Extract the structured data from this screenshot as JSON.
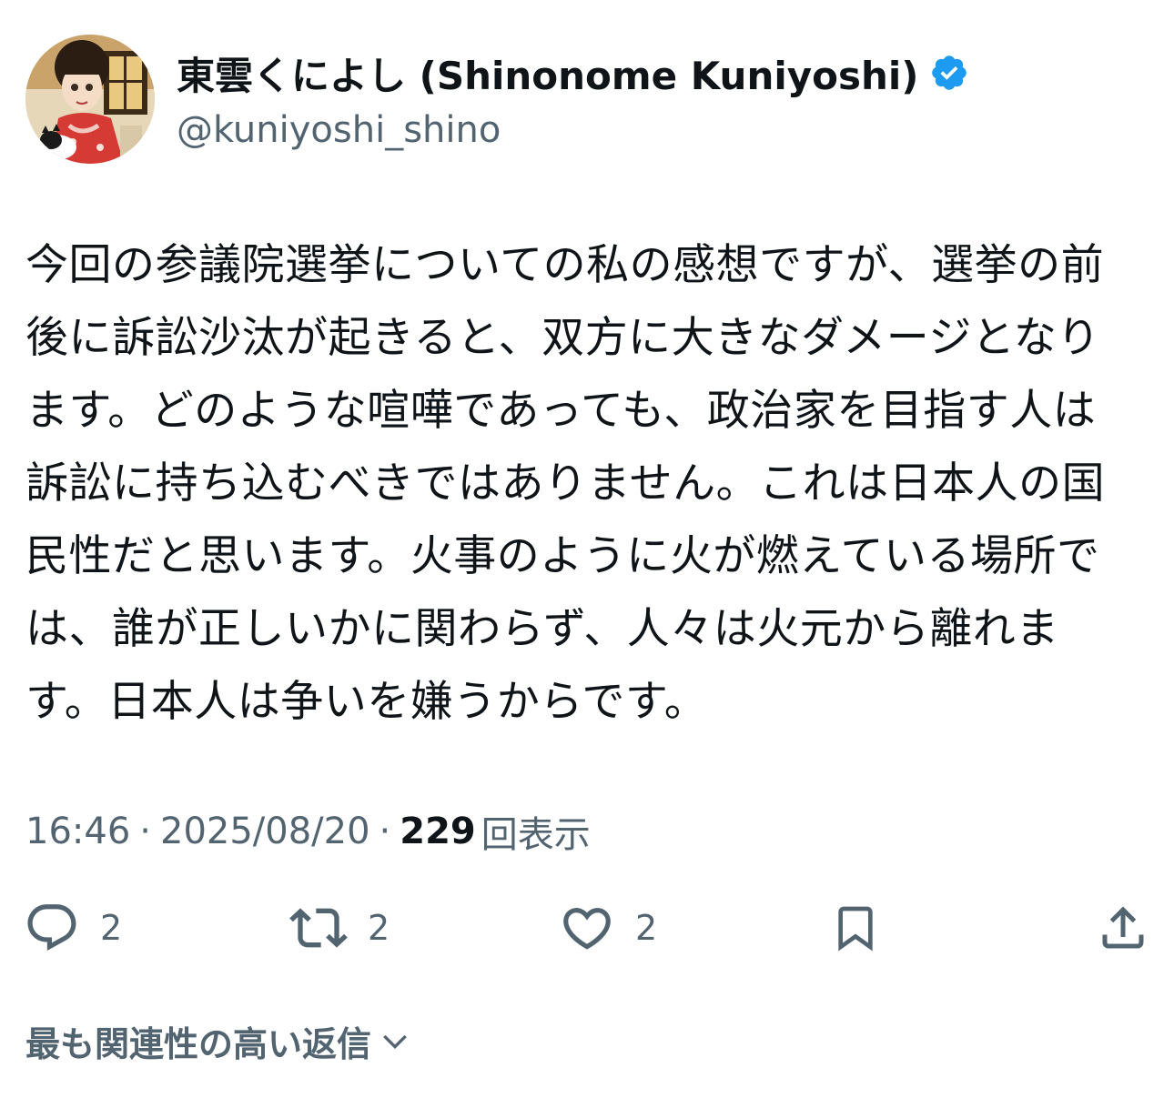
{
  "author": {
    "display_name": "東雲くによし (Shinonome Kuniyoshi)",
    "handle": "@kuniyoshi_shino",
    "verified": true,
    "avatar_icon": "avatar-illustration",
    "verified_icon": "verified-badge-icon"
  },
  "tweet": {
    "text": "今回の参議院選挙についての私の感想ですが、選挙の前後に訴訟沙汰が起きると、双方に大きなダメージとなります。どのような喧嘩であっても、政治家を目指す人は訴訟に持ち込むべきではありません。これは日本人の国民性だと思います。火事のように火が燃えている場所では、誰が正しいかに関わらず、人々は火元から離れます。日本人は争いを嫌うからです。"
  },
  "meta": {
    "time": "16:46",
    "separator": "·",
    "date": "2025/08/20",
    "views_count": "229",
    "views_label": "回表示"
  },
  "actions": {
    "reply": {
      "icon": "reply-icon",
      "count": "2"
    },
    "retweet": {
      "icon": "retweet-icon",
      "count": "2"
    },
    "like": {
      "icon": "heart-icon",
      "count": "2"
    },
    "bookmark": {
      "icon": "bookmark-icon"
    },
    "share": {
      "icon": "share-icon"
    }
  },
  "replies": {
    "sort_label": "最も関連性の高い返信",
    "sort_icon": "chevron-down-icon"
  },
  "colors": {
    "text_primary": "#0f1419",
    "text_secondary": "#536471",
    "verified_blue": "#1d9bf0",
    "background": "#ffffff"
  }
}
